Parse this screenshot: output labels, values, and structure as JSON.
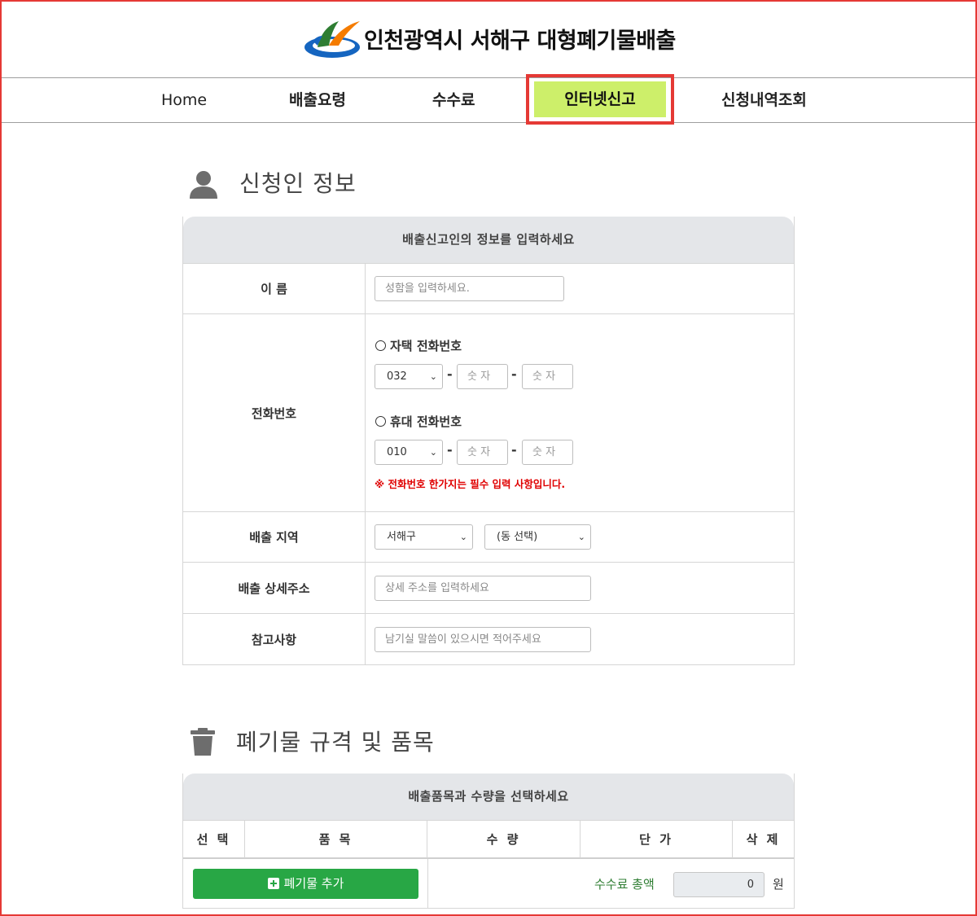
{
  "header": {
    "site_title": "인천광역시 서해구 대형폐기물배출",
    "logo_icon": "city-logo-icon"
  },
  "nav": {
    "items": [
      {
        "label": "Home"
      },
      {
        "label": "배출요령"
      },
      {
        "label": "수수료"
      },
      {
        "label": "인터넷신고",
        "active": true
      },
      {
        "label": "신청내역조회"
      }
    ],
    "active_color": "#cdef6a",
    "highlight_color": "#e53935"
  },
  "applicant": {
    "section_title": "신청인 정보",
    "panel_heading": "배출신고인의 정보를 입력하세요",
    "name_label": "이 름",
    "name_placeholder": "성함을 입력하세요.",
    "phone_label": "전화번호",
    "home_phone_label": "자택 전화번호",
    "home_area_code": "032",
    "mobile_phone_label": "휴대 전화번호",
    "mobile_prefix": "010",
    "digits_placeholder": "숫 자",
    "dash": "-",
    "phone_warning": "※ 전화번호 한가지는 필수 입력 사항입니다.",
    "region_label": "배출 지역",
    "district_value": "서해구",
    "dong_value": "(동 선택)",
    "address_label": "배출 상세주소",
    "address_placeholder": "상세 주소를 입력하세요",
    "notes_label": "참고사항",
    "notes_placeholder": "남기실 말씀이 있으시면 적어주세요"
  },
  "waste": {
    "section_title": "폐기물 규격 및 품목",
    "panel_heading": "배출품목과 수량을 선택하세요",
    "columns": [
      "선 택",
      "품 목",
      "수 량",
      "단 가",
      "삭 제"
    ],
    "add_button_label": "폐기물 추가",
    "fee_total_label": "수수료 총액",
    "fee_total_value": "0",
    "fee_unit": "원",
    "add_button_color": "#28a745"
  }
}
